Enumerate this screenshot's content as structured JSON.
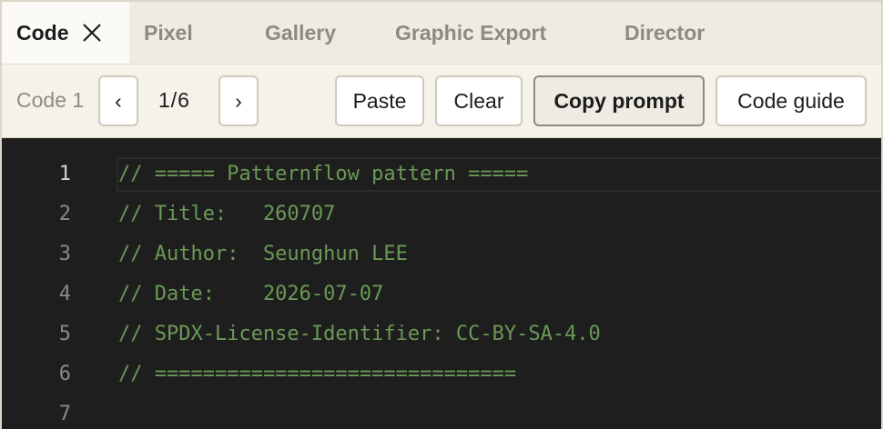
{
  "tabs": [
    {
      "label": "Code",
      "active": true
    },
    {
      "label": "Pixel"
    },
    {
      "label": "Gallery"
    },
    {
      "label": "Graphic Export"
    },
    {
      "label": "Director"
    }
  ],
  "toolbar": {
    "code_label": "Code 1",
    "prev_label": "‹",
    "page_indicator": "1/6",
    "next_label": "›",
    "paste_label": "Paste",
    "clear_label": "Clear",
    "copy_prompt_label": "Copy prompt",
    "code_guide_label": "Code guide"
  },
  "editor": {
    "current_line": 1,
    "lines": [
      {
        "number": "1",
        "text": "// ===== Patternflow pattern ====="
      },
      {
        "number": "2",
        "text": "// Title:   260707"
      },
      {
        "number": "3",
        "text": "// Author:  Seunghun LEE"
      },
      {
        "number": "4",
        "text": "// Date:    2026-07-07"
      },
      {
        "number": "5",
        "text": "// SPDX-License-Identifier: CC-BY-SA-4.0"
      },
      {
        "number": "6",
        "text": "// =============================="
      },
      {
        "number": "7",
        "text": ""
      }
    ]
  },
  "colors": {
    "comment": "#6a9955",
    "editor_bg": "#1e1e1e",
    "tabbar_bg": "#eeebe2",
    "toolbar_bg": "#f5f2ea"
  }
}
